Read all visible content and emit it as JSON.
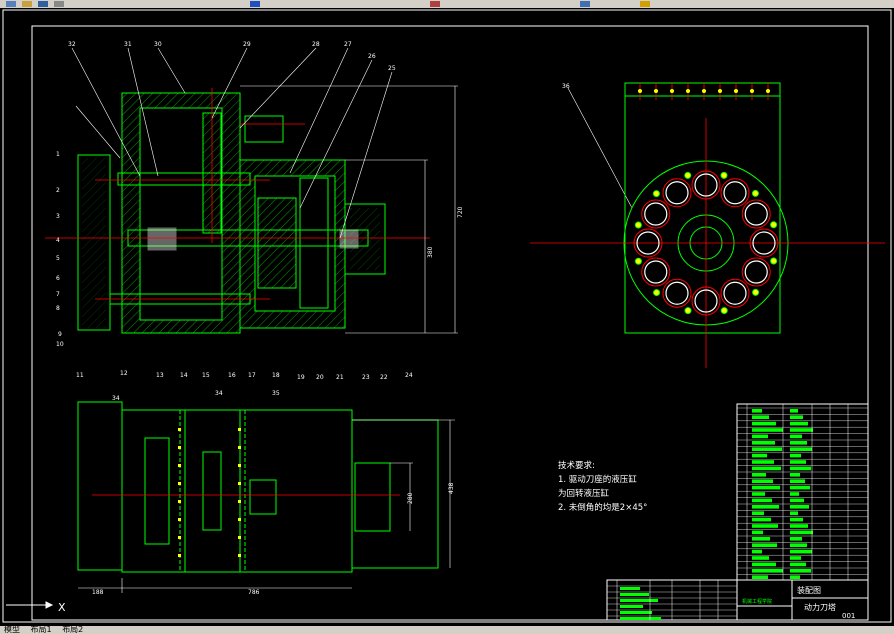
{
  "app": {
    "tabs": [
      "模型",
      "布局1",
      "布局2"
    ]
  },
  "drawing": {
    "part_numbers_top": [
      "32",
      "31",
      "30",
      "29",
      "28",
      "27",
      "26",
      "25"
    ],
    "part_numbers_left": [
      "1",
      "2",
      "3",
      "4",
      "5",
      "6",
      "7",
      "8",
      "9",
      "10"
    ],
    "part_numbers_bottom": [
      "11",
      "12",
      "13",
      "14",
      "15",
      "16",
      "17",
      "18",
      "19",
      "20",
      "21",
      "23",
      "22",
      "24"
    ],
    "right_view_label": "36",
    "bottom_view_labels": [
      "34",
      "35"
    ],
    "dimensions": {
      "dim_height_outer": "720",
      "dim_height_inner": "380",
      "dim_bottom_left": "188",
      "dim_bottom_main": "786",
      "dim_flange_width": "34",
      "dim_flange_height": "280",
      "dim_total_height": "438"
    },
    "notes": {
      "heading": "技术要求:",
      "line1": "1. 驱动刀座的液压缸",
      "line2": "为回转液压缸",
      "line3": "2. 未倒角的均是2×45°"
    },
    "title_block": {
      "drawing_name": "装配图",
      "part_name": "动力刀塔",
      "drawing_number": "001",
      "school": "机械工程学院"
    }
  },
  "colors": {
    "outline": "#00ff00",
    "center": "#ff0000",
    "hatch": "#00ff00",
    "border": "#ffffff",
    "accent_yellow": "#ffff00"
  }
}
